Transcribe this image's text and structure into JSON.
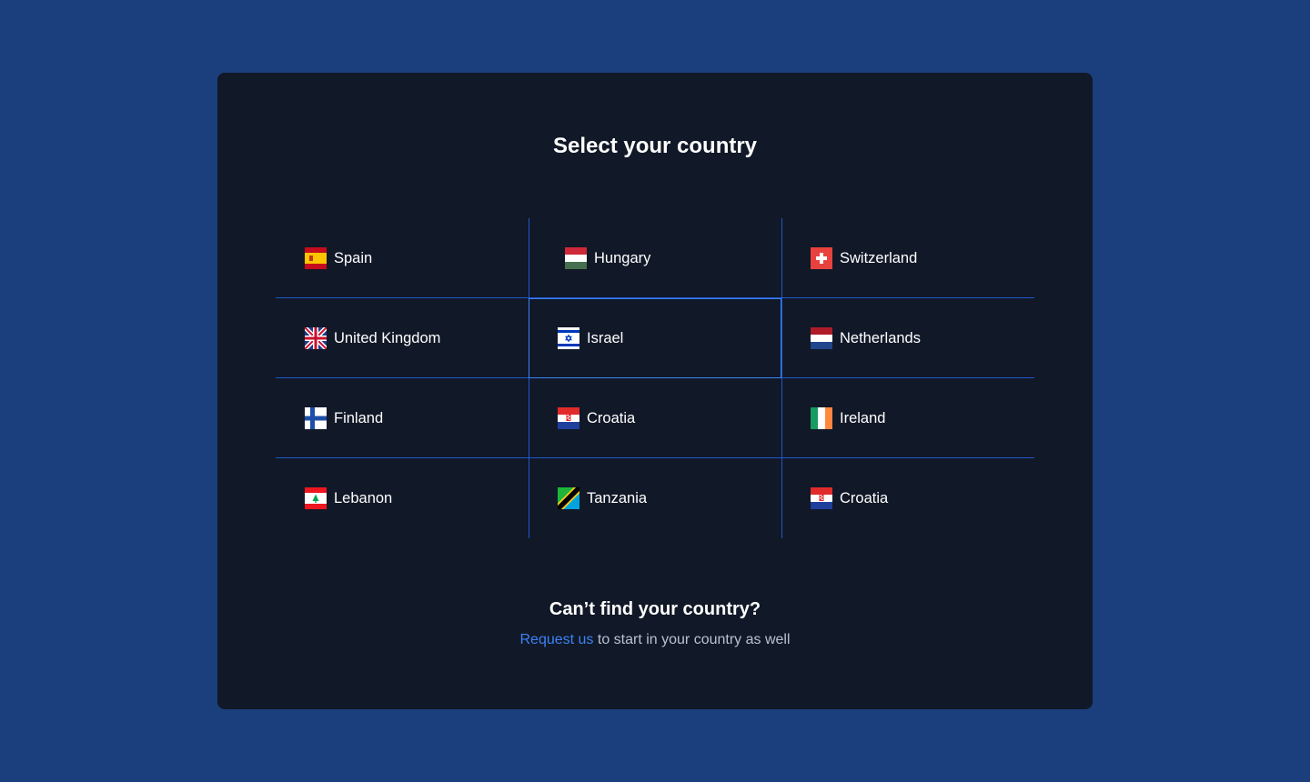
{
  "heading": "Select your country",
  "countries": [
    {
      "label": "Spain",
      "flag": "spain-flag-icon"
    },
    {
      "label": "Hungary",
      "flag": "hungary-flag-icon"
    },
    {
      "label": "Switzerland",
      "flag": "switzerland-flag-icon"
    },
    {
      "label": "United Kingdom",
      "flag": "united-kingdom-flag-icon"
    },
    {
      "label": "Israel",
      "flag": "israel-flag-icon",
      "selected": true
    },
    {
      "label": "Netherlands",
      "flag": "netherlands-flag-icon"
    },
    {
      "label": "Finland",
      "flag": "finland-flag-icon"
    },
    {
      "label": "Croatia",
      "flag": "croatia-flag-icon"
    },
    {
      "label": "Ireland",
      "flag": "ireland-flag-icon"
    },
    {
      "label": "Lebanon",
      "flag": "lebanon-flag-icon"
    },
    {
      "label": "Tanzania",
      "flag": "tanzania-flag-icon"
    },
    {
      "label": "Croatia",
      "flag": "croatia-flag-icon"
    }
  ],
  "footer": {
    "title": "Can’t find your country?",
    "link_text": "Request us",
    "rest_text": " to start in your country as well"
  },
  "colors": {
    "page_background": "#1b3f7d",
    "card_background": "#111827",
    "grid_lines": "#2563eb",
    "link": "#3b82f6"
  }
}
